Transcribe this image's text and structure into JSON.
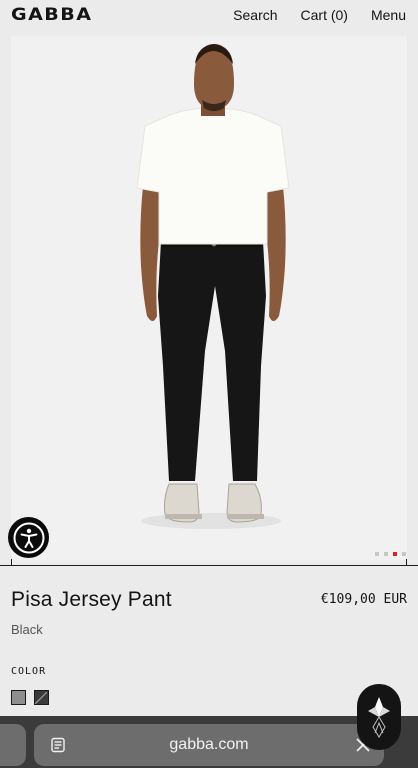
{
  "header": {
    "logo": "GABBA",
    "nav": {
      "search": "Search",
      "cart": "Cart (0)",
      "menu": "Menu"
    }
  },
  "product": {
    "title": "Pisa Jersey Pant",
    "price": "€109,00 EUR",
    "color_name": "Black",
    "color_label": "COLOR",
    "swatches": [
      "grey",
      "black"
    ]
  },
  "carousel": {
    "total": 4,
    "active": 3
  },
  "browser": {
    "url": "gabba.com"
  },
  "colors": {
    "background": "#ebebeb",
    "accent_dot": "#d8232a",
    "bar": "#3b3b3b",
    "address": "#6d6d6d"
  }
}
